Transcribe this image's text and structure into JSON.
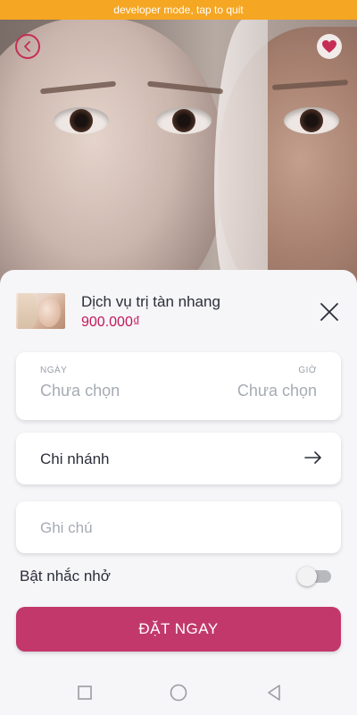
{
  "dev_banner": "developer mode, tap to quit",
  "service": {
    "name": "Dịch vụ trị tàn nhang",
    "price": "900.000₫"
  },
  "booking": {
    "date_label": "NGÀY",
    "date_value": "Chưa chọn",
    "time_label": "GIỜ",
    "time_value": "Chưa chọn",
    "branch_label": "Chi nhánh",
    "note_placeholder": "Ghi chú",
    "reminder_label": "Bật nhắc nhở",
    "reminder_on": false,
    "submit_label": "ĐẶT NGAY"
  },
  "colors": {
    "accent": "#c2386a",
    "price": "#c2185b",
    "dev_banner": "#f5a623"
  },
  "icons": {
    "back": "chevron-left-icon",
    "favorite": "heart-icon",
    "close": "close-icon",
    "branch": "arrow-right-icon",
    "nav": [
      "square-icon",
      "circle-icon",
      "triangle-back-icon"
    ]
  }
}
